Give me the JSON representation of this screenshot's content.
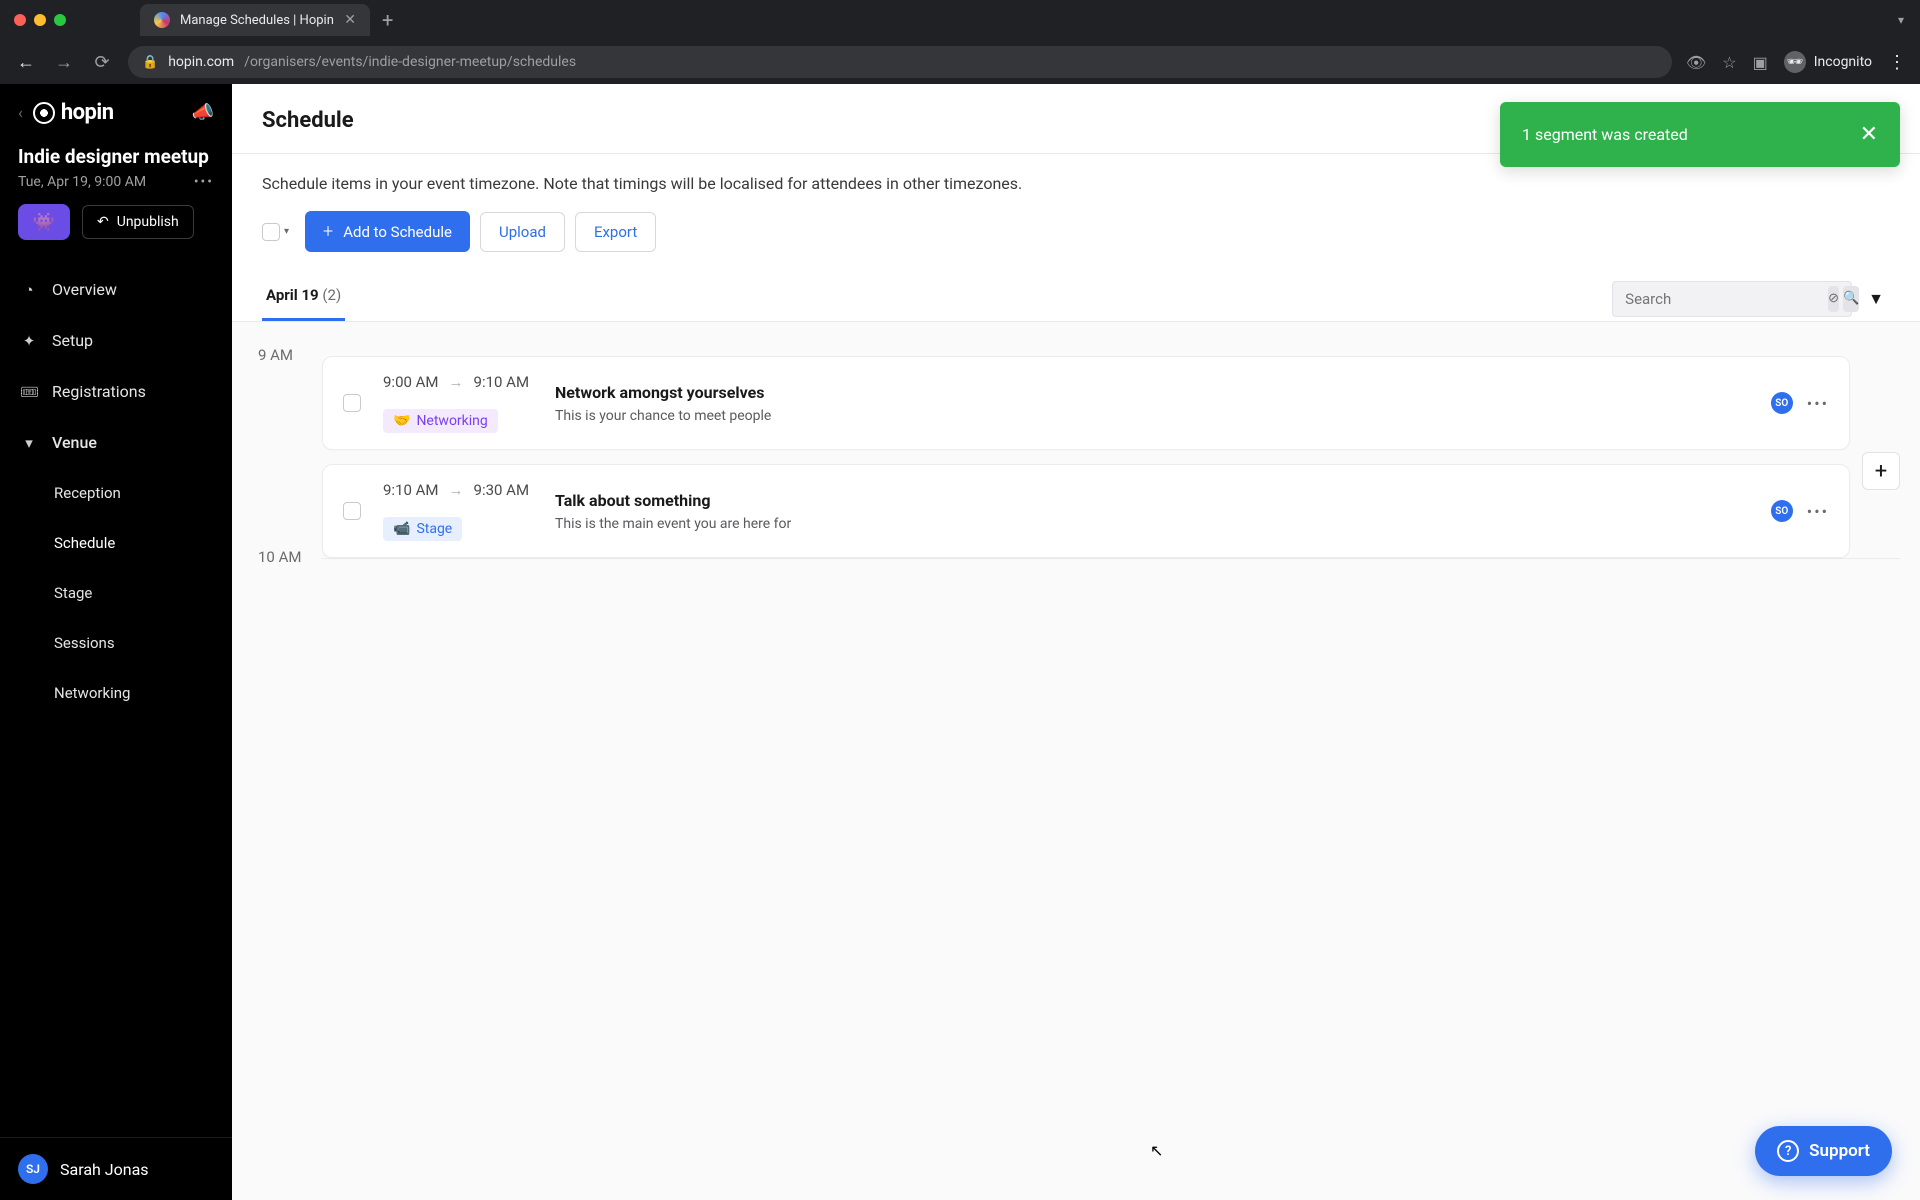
{
  "browser": {
    "tab_title": "Manage Schedules | Hopin",
    "url_host": "hopin.com",
    "url_path": "/organisers/events/indie-designer-meetup/schedules",
    "incognito_label": "Incognito"
  },
  "sidebar": {
    "logo_text": "hopin",
    "event_title": "Indie designer meetup",
    "event_date": "Tue, Apr 19, 9:00 AM",
    "unpublish_label": "Unpublish",
    "nav": {
      "overview": "Overview",
      "setup": "Setup",
      "registrations": "Registrations",
      "venue": "Venue",
      "reception": "Reception",
      "schedule": "Schedule",
      "stage": "Stage",
      "sessions": "Sessions",
      "networking": "Networking"
    },
    "user_initials": "SJ",
    "user_name": "Sarah Jonas"
  },
  "page": {
    "title": "Schedule",
    "description": "Schedule items in your event timezone. Note that timings will be localised for attendees in other timezones.",
    "toast": "1 segment was created",
    "toolbar": {
      "add_label": "Add to Schedule",
      "upload_label": "Upload",
      "export_label": "Export"
    },
    "tab": {
      "label": "April 19",
      "count": "(2)"
    },
    "search_placeholder": "Search",
    "hours": {
      "nine": "9 AM",
      "ten": "10 AM"
    },
    "segments": [
      {
        "start": "9:00 AM",
        "end": "9:10 AM",
        "tag": "Networking",
        "tag_type": "net",
        "title": "Network amongst yourselves",
        "desc": "This is your chance to meet people",
        "pill": "SO"
      },
      {
        "start": "9:10 AM",
        "end": "9:30 AM",
        "tag": "Stage",
        "tag_type": "stage",
        "title": "Talk about something",
        "desc": "This is the main event you are here for",
        "pill": "SO"
      }
    ],
    "support_label": "Support"
  }
}
